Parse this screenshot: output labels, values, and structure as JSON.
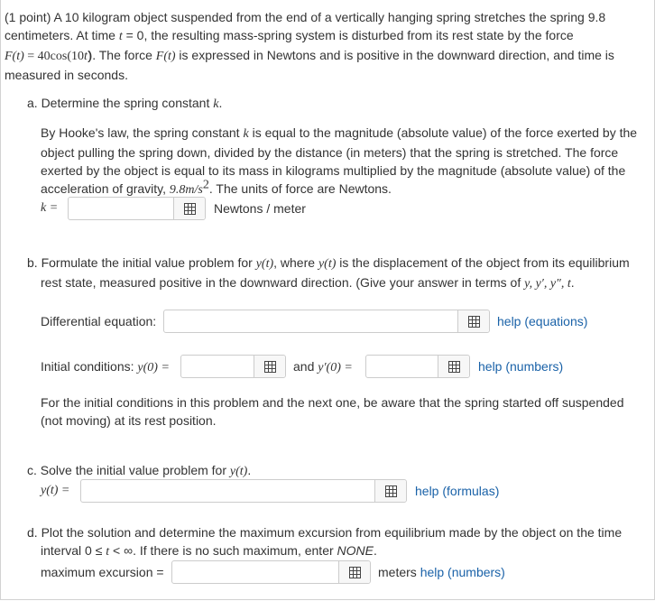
{
  "intro": {
    "points": "(1 point)",
    "line1": " A 10 kilogram object suspended from the end of a vertically hanging spring stretches the spring 9.8",
    "line2a": "centimeters. At time ",
    "t": "t",
    "line2b": " = 0, the resulting mass-spring system is disturbed from its rest state by the force",
    "F_t": "F(t)",
    "line3a": " = 40cos(10",
    "t2": "t",
    "line3b": "). The force ",
    "F_t2": "F(t)",
    "line3c": " is expressed in Newtons and is positive in the downward direction, and time is",
    "line4": "measured in seconds."
  },
  "part_a": {
    "heading": "a. Determine the spring constant ",
    "k": "k",
    "heading_end": ".",
    "p1": "By Hooke's law, the spring constant ",
    "p1k": "k",
    "p1b": " is equal to the magnitude (absolute value) of the force exerted by the",
    "p2": "object pulling the spring down, divided by the distance (in meters) that the spring is stretched. The force",
    "p3": "exerted by the object is equal to its mass in kilograms multiplied by the magnitude (absolute value) of the",
    "p4a": "acceleration of gravity, ",
    "g": "9.8m/s",
    "g_exp": "2",
    "p4b": ". The units of force are Newtons.",
    "label": "k =",
    "units": "Newtons / meter",
    "value": ""
  },
  "part_b": {
    "h1a": "b. Formulate the initial value problem for ",
    "y_t": "y(t)",
    "h1b": ", where ",
    "y_t2": "y(t)",
    "h1c": " is the displacement of the object from its equilibrium",
    "h2a": "rest state, measured positive in the downward direction. (Give your answer in terms of ",
    "vars": "y, y′, y″, t",
    "h2b": ".",
    "de_label": "Differential equation:",
    "de_help": "help (equations)",
    "ic_label": "Initial conditions: ",
    "ic_y0": "y(0) =",
    "ic_and": "and ",
    "ic_yp0": "y′(0) =",
    "ic_help": "help (numbers)",
    "note1": "For the initial conditions in this problem and the next one, be aware that the spring started off suspended",
    "note2": "(not moving) at its rest position."
  },
  "part_c": {
    "heading": "c. Solve the initial value problem for ",
    "y_t": "y(t)",
    "heading_end": ".",
    "label": "y(t) =",
    "help": "help (formulas)"
  },
  "part_d": {
    "h1": "d. Plot the solution and determine the maximum excursion from equilibrium made by the object on the time",
    "h2a": "interval 0 ≤ ",
    "t": "t",
    "h2b": " < ∞. If there is no such maximum, enter ",
    "none": "NONE",
    "h2c": ".",
    "label": "maximum excursion =",
    "units": "meters ",
    "help": "help (numbers)"
  }
}
